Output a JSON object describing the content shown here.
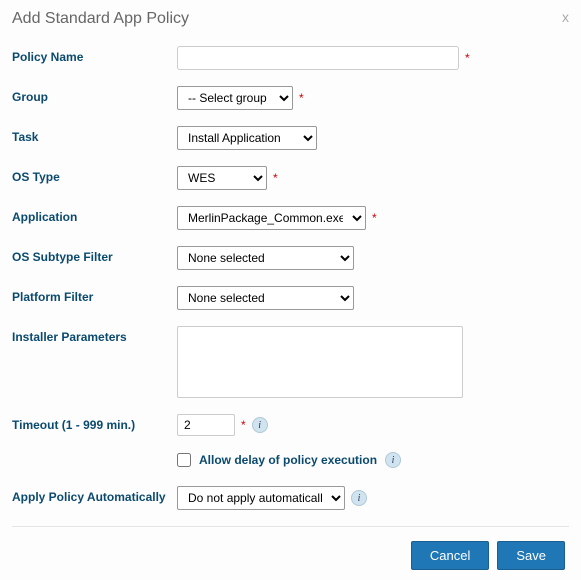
{
  "dialog": {
    "title": "Add Standard App Policy",
    "close": "x"
  },
  "labels": {
    "policy_name": "Policy Name",
    "group": "Group",
    "task": "Task",
    "os_type": "OS Type",
    "application": "Application",
    "os_subtype_filter": "OS Subtype Filter",
    "platform_filter": "Platform Filter",
    "installer_parameters": "Installer Parameters",
    "timeout": "Timeout (1 - 999 min.)",
    "allow_delay": "Allow delay of policy execution",
    "apply_policy": "Apply Policy Automatically"
  },
  "values": {
    "policy_name": "",
    "group": "-- Select group --",
    "task": "Install Application",
    "os_type": "WES",
    "application": "MerlinPackage_Common.exe (Loc",
    "os_subtype_filter": "None selected",
    "platform_filter": "None selected",
    "installer_parameters": "",
    "timeout": "2",
    "allow_delay_checked": false,
    "apply_policy": "Do not apply automatically"
  },
  "required_mark": "*",
  "info_glyph": "i",
  "buttons": {
    "cancel": "Cancel",
    "save": "Save"
  }
}
